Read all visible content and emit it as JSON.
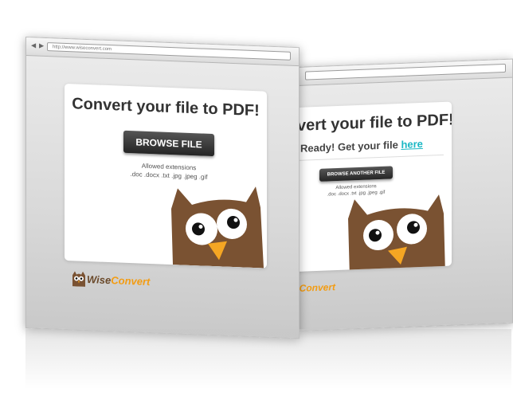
{
  "left_window": {
    "back_icon": "◀",
    "forward_icon": "▶",
    "url": "http://www.wiseconvert.com",
    "title": "Convert your file to PDF!",
    "browse_label": "BROWSE FILE",
    "extensions_label": "Allowed extensions",
    "extensions_list": ".doc .docx .txt .jpg .jpeg .gif",
    "logo_wise": "Wise",
    "logo_convert": "Convert"
  },
  "right_window": {
    "title": "vert your file to PDF!",
    "ready_text": "Ready! Get your file",
    "here_link": "here",
    "browse_another_label": "BROWSE ANOTHER FILE",
    "extensions_label": "Allowed extensions",
    "extensions_list": ".doc .docx .txt .jpg .jpeg .gif",
    "logo_partial": "eConvert"
  },
  "colors": {
    "owl_brown": "#7a5232",
    "owl_beak": "#f5a623",
    "link_teal": "#1ab7c4",
    "logo_orange": "#f39c12"
  }
}
